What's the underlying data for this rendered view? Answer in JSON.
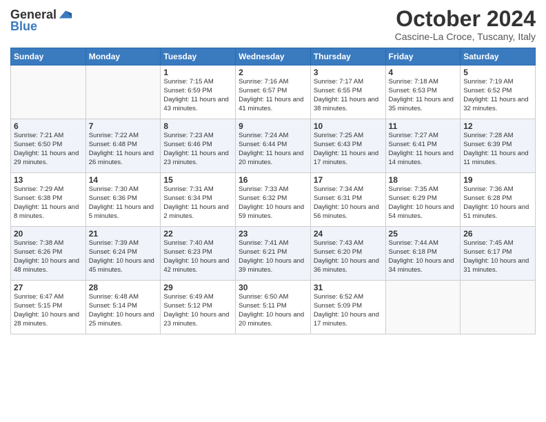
{
  "header": {
    "logo_general": "General",
    "logo_blue": "Blue",
    "month_title": "October 2024",
    "location": "Cascine-La Croce, Tuscany, Italy"
  },
  "days_of_week": [
    "Sunday",
    "Monday",
    "Tuesday",
    "Wednesday",
    "Thursday",
    "Friday",
    "Saturday"
  ],
  "weeks": [
    [
      {
        "day": "",
        "empty": true
      },
      {
        "day": "",
        "empty": true
      },
      {
        "day": "1",
        "sunrise": "7:15 AM",
        "sunset": "6:59 PM",
        "daylight": "11 hours and 43 minutes."
      },
      {
        "day": "2",
        "sunrise": "7:16 AM",
        "sunset": "6:57 PM",
        "daylight": "11 hours and 41 minutes."
      },
      {
        "day": "3",
        "sunrise": "7:17 AM",
        "sunset": "6:55 PM",
        "daylight": "11 hours and 38 minutes."
      },
      {
        "day": "4",
        "sunrise": "7:18 AM",
        "sunset": "6:53 PM",
        "daylight": "11 hours and 35 minutes."
      },
      {
        "day": "5",
        "sunrise": "7:19 AM",
        "sunset": "6:52 PM",
        "daylight": "11 hours and 32 minutes."
      }
    ],
    [
      {
        "day": "6",
        "sunrise": "7:21 AM",
        "sunset": "6:50 PM",
        "daylight": "11 hours and 29 minutes."
      },
      {
        "day": "7",
        "sunrise": "7:22 AM",
        "sunset": "6:48 PM",
        "daylight": "11 hours and 26 minutes."
      },
      {
        "day": "8",
        "sunrise": "7:23 AM",
        "sunset": "6:46 PM",
        "daylight": "11 hours and 23 minutes."
      },
      {
        "day": "9",
        "sunrise": "7:24 AM",
        "sunset": "6:44 PM",
        "daylight": "11 hours and 20 minutes."
      },
      {
        "day": "10",
        "sunrise": "7:25 AM",
        "sunset": "6:43 PM",
        "daylight": "11 hours and 17 minutes."
      },
      {
        "day": "11",
        "sunrise": "7:27 AM",
        "sunset": "6:41 PM",
        "daylight": "11 hours and 14 minutes."
      },
      {
        "day": "12",
        "sunrise": "7:28 AM",
        "sunset": "6:39 PM",
        "daylight": "11 hours and 11 minutes."
      }
    ],
    [
      {
        "day": "13",
        "sunrise": "7:29 AM",
        "sunset": "6:38 PM",
        "daylight": "11 hours and 8 minutes."
      },
      {
        "day": "14",
        "sunrise": "7:30 AM",
        "sunset": "6:36 PM",
        "daylight": "11 hours and 5 minutes."
      },
      {
        "day": "15",
        "sunrise": "7:31 AM",
        "sunset": "6:34 PM",
        "daylight": "11 hours and 2 minutes."
      },
      {
        "day": "16",
        "sunrise": "7:33 AM",
        "sunset": "6:32 PM",
        "daylight": "10 hours and 59 minutes."
      },
      {
        "day": "17",
        "sunrise": "7:34 AM",
        "sunset": "6:31 PM",
        "daylight": "10 hours and 56 minutes."
      },
      {
        "day": "18",
        "sunrise": "7:35 AM",
        "sunset": "6:29 PM",
        "daylight": "10 hours and 54 minutes."
      },
      {
        "day": "19",
        "sunrise": "7:36 AM",
        "sunset": "6:28 PM",
        "daylight": "10 hours and 51 minutes."
      }
    ],
    [
      {
        "day": "20",
        "sunrise": "7:38 AM",
        "sunset": "6:26 PM",
        "daylight": "10 hours and 48 minutes."
      },
      {
        "day": "21",
        "sunrise": "7:39 AM",
        "sunset": "6:24 PM",
        "daylight": "10 hours and 45 minutes."
      },
      {
        "day": "22",
        "sunrise": "7:40 AM",
        "sunset": "6:23 PM",
        "daylight": "10 hours and 42 minutes."
      },
      {
        "day": "23",
        "sunrise": "7:41 AM",
        "sunset": "6:21 PM",
        "daylight": "10 hours and 39 minutes."
      },
      {
        "day": "24",
        "sunrise": "7:43 AM",
        "sunset": "6:20 PM",
        "daylight": "10 hours and 36 minutes."
      },
      {
        "day": "25",
        "sunrise": "7:44 AM",
        "sunset": "6:18 PM",
        "daylight": "10 hours and 34 minutes."
      },
      {
        "day": "26",
        "sunrise": "7:45 AM",
        "sunset": "6:17 PM",
        "daylight": "10 hours and 31 minutes."
      }
    ],
    [
      {
        "day": "27",
        "sunrise": "6:47 AM",
        "sunset": "5:15 PM",
        "daylight": "10 hours and 28 minutes."
      },
      {
        "day": "28",
        "sunrise": "6:48 AM",
        "sunset": "5:14 PM",
        "daylight": "10 hours and 25 minutes."
      },
      {
        "day": "29",
        "sunrise": "6:49 AM",
        "sunset": "5:12 PM",
        "daylight": "10 hours and 23 minutes."
      },
      {
        "day": "30",
        "sunrise": "6:50 AM",
        "sunset": "5:11 PM",
        "daylight": "10 hours and 20 minutes."
      },
      {
        "day": "31",
        "sunrise": "6:52 AM",
        "sunset": "5:09 PM",
        "daylight": "10 hours and 17 minutes."
      },
      {
        "day": "",
        "empty": true
      },
      {
        "day": "",
        "empty": true
      }
    ]
  ],
  "labels": {
    "sunrise": "Sunrise:",
    "sunset": "Sunset:",
    "daylight": "Daylight:"
  }
}
